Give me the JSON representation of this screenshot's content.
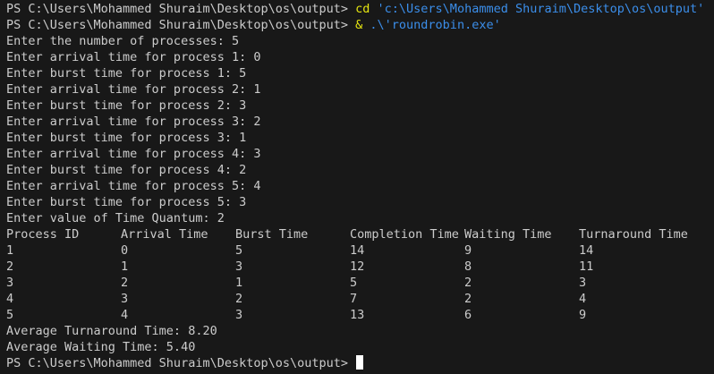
{
  "colors": {
    "background": "#181818",
    "text": "#cccccc",
    "command": "#e5e510",
    "string": "#3b8eea",
    "cursor": "#ffffff"
  },
  "cmd1": {
    "prompt": "PS C:\\Users\\Mohammed Shuraim\\Desktop\\os\\output> ",
    "command": "cd",
    "argument": " 'c:\\Users\\Mohammed Shuraim\\Desktop\\os\\output'"
  },
  "cmd2": {
    "prompt": "PS C:\\Users\\Mohammed Shuraim\\Desktop\\os\\output> ",
    "operator": "& ",
    "argument": ".\\'roundrobin.exe'"
  },
  "inputs": [
    "Enter the number of processes: 5",
    "Enter arrival time for process 1: 0",
    "Enter burst time for process 1: 5",
    "Enter arrival time for process 2: 1",
    "Enter burst time for process 2: 3",
    "Enter arrival time for process 3: 2",
    "Enter burst time for process 3: 1",
    "Enter arrival time for process 4: 3",
    "Enter burst time for process 4: 2",
    "Enter arrival time for process 5: 4",
    "Enter burst time for process 5: 3",
    "Enter value of Time Quantum: 2"
  ],
  "table": {
    "headers": [
      "Process ID",
      "Arrival Time",
      "Burst Time",
      "Completion Time",
      "Waiting Time",
      "Turnaround Time"
    ],
    "rows": [
      [
        "1",
        "0",
        "5",
        "14",
        "9",
        "14"
      ],
      [
        "2",
        "1",
        "3",
        "12",
        "8",
        "11"
      ],
      [
        "3",
        "2",
        "1",
        "5",
        "2",
        "3"
      ],
      [
        "4",
        "3",
        "2",
        "7",
        "2",
        "4"
      ],
      [
        "5",
        "4",
        "3",
        "13",
        "6",
        "9"
      ]
    ]
  },
  "averages": {
    "turnaround": "Average Turnaround Time: 8.20",
    "waiting": "Average Waiting Time: 5.40"
  },
  "final_prompt": "PS C:\\Users\\Mohammed Shuraim\\Desktop\\os\\output> "
}
